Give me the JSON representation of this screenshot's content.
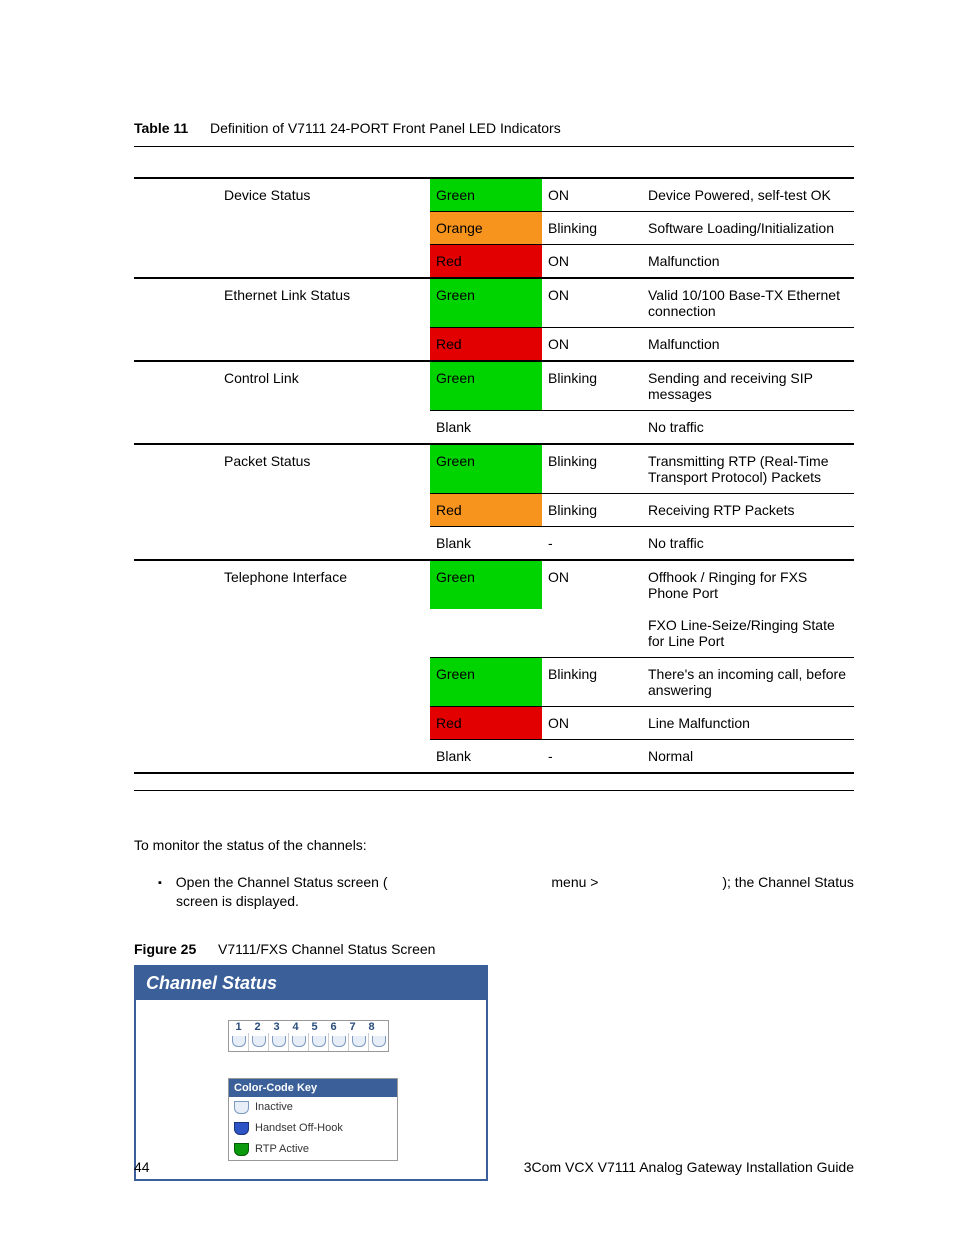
{
  "table": {
    "label": "Table 11",
    "title": "Definition of V7111 24-PORT Front Panel LED Indicators",
    "groups": [
      {
        "name": "Device Status",
        "rows": [
          {
            "color": "Green",
            "swatch": "green",
            "state": "ON",
            "desc": "Device Powered, self-test OK"
          },
          {
            "color": "Orange",
            "swatch": "orange",
            "state": "Blinking",
            "desc": "Software Loading/Initialization"
          },
          {
            "color": "Red",
            "swatch": "red",
            "state": "ON",
            "desc": "Malfunction"
          }
        ]
      },
      {
        "name": "Ethernet Link Status",
        "rows": [
          {
            "color": "Green",
            "swatch": "green",
            "state": "ON",
            "desc": "Valid 10/100 Base-TX Ethernet connection"
          },
          {
            "color": "Red",
            "swatch": "red",
            "state": "ON",
            "desc": "Malfunction"
          }
        ]
      },
      {
        "name": "Control Link",
        "rows": [
          {
            "color": "Green",
            "swatch": "green",
            "state": "Blinking",
            "desc": "Sending and receiving SIP messages"
          },
          {
            "color": "Blank",
            "swatch": "",
            "state": "",
            "desc": "No traffic"
          }
        ]
      },
      {
        "name": "Packet Status",
        "rows": [
          {
            "color": "Green",
            "swatch": "green",
            "state": "Blinking",
            "desc": "Transmitting RTP (Real-Time Transport Protocol) Packets"
          },
          {
            "color": "Red",
            "swatch": "orange",
            "state": "Blinking",
            "desc": "Receiving RTP Packets"
          },
          {
            "color": "Blank",
            "swatch": "",
            "state": "-",
            "desc": "No traffic"
          }
        ]
      },
      {
        "name": "Telephone Interface",
        "rows": [
          {
            "color": "Green",
            "swatch": "green",
            "state": "ON",
            "desc": "Offhook / Ringing for FXS Phone Port",
            "desc2": "FXO Line-Seize/Ringing State for Line Port"
          },
          {
            "color": "Green",
            "swatch": "green",
            "state": "Blinking",
            "desc": "There's an incoming call, before answering"
          },
          {
            "color": "Red",
            "swatch": "red",
            "state": "ON",
            "desc": "Line Malfunction"
          },
          {
            "color": "Blank",
            "swatch": "",
            "state": "-",
            "desc": "Normal"
          }
        ]
      }
    ]
  },
  "body": {
    "intro": "To monitor the status of the channels:",
    "bullet_a": "Open the Channel Status screen (",
    "bullet_b": " menu > ",
    "bullet_c": "); the Channel Status screen is displayed."
  },
  "figure": {
    "label": "Figure 25",
    "title": "V7111/FXS Channel Status Screen",
    "header": "Channel Status",
    "ports": [
      "1",
      "2",
      "3",
      "4",
      "5",
      "6",
      "7",
      "8"
    ],
    "legend_title": "Color-Code Key",
    "legend": [
      {
        "label": "Inactive",
        "cls": "sw-inactive"
      },
      {
        "label": "Handset Off-Hook",
        "cls": "sw-offhook"
      },
      {
        "label": "RTP Active",
        "cls": "sw-rtp"
      }
    ]
  },
  "footer": {
    "page": "44",
    "doc": "3Com VCX V7111 Analog Gateway Installation Guide"
  }
}
